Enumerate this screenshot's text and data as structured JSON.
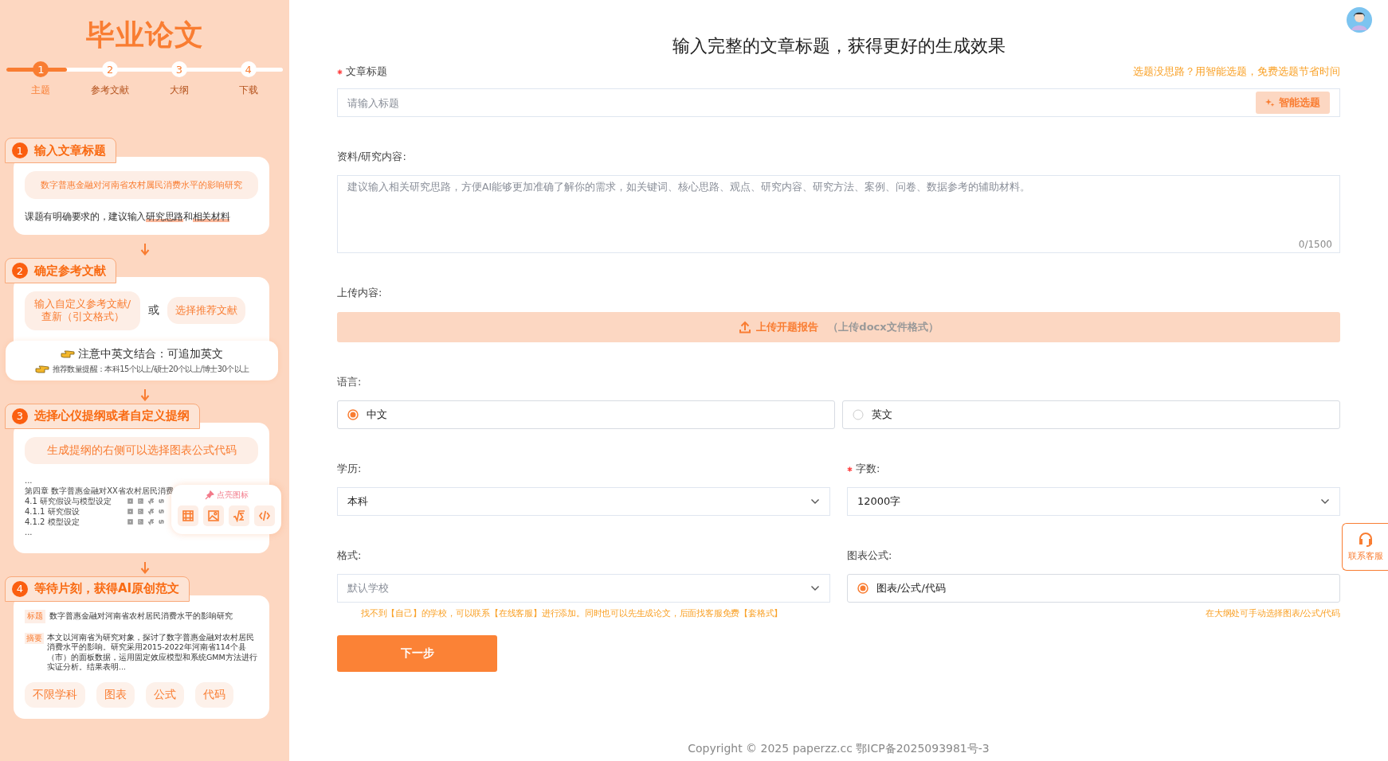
{
  "sidebar": {
    "title": "毕业论文",
    "steps": [
      {
        "number": "1",
        "label": "主题",
        "selected": true
      },
      {
        "number": "2",
        "label": "参考文献",
        "selected": false
      },
      {
        "number": "3",
        "label": "大纲",
        "selected": false
      },
      {
        "number": "4",
        "label": "下载",
        "selected": false
      }
    ],
    "guide_sections": [
      {
        "kind": "title",
        "number": "1",
        "heading": "输入文章标题",
        "example": "数字普惠金融对河南省农村属民消费水平的影响研究",
        "hint": "课题有明确要求的，建议输入**研究思路**和**相关材料**"
      },
      {
        "kind": "references",
        "number": "2",
        "heading": "确定参考文献",
        "options": [
          "输入自定义参考文献/查新（引文格式）",
          "选择推荐文献"
        ],
        "separator": "或",
        "notes": [
          "注意中英文结合：可追加英文",
          "推荐数量提醒：本科15个以上/硕士20个以上/博士30个以上"
        ]
      },
      {
        "kind": "outline",
        "number": "3",
        "heading": "选择心仪提纲或者自定义提纲",
        "banner": "生成提纲的右侧可以选择图表公式代码",
        "outline_lines": [
          {
            "text": "...",
            "kind": "plain"
          },
          {
            "text": "第四章 数字普惠金融对XX省农村居民消费",
            "kind": "plain"
          },
          {
            "text": "4.1 研究假设与模型设定",
            "kind": "icons"
          },
          {
            "text": "4.1.1 研究假设",
            "kind": "icons"
          },
          {
            "text": "4.1.2 模型设定",
            "kind": "icons"
          },
          {
            "text": "...",
            "kind": "plain"
          }
        ],
        "popover_label": "点亮图标"
      },
      {
        "kind": "sample",
        "number": "4",
        "heading": "等待片刻，获得AI原创范文",
        "title_tag": "标题",
        "title": "数字普惠金融对河南省农村居民消费水平的影响研究",
        "abstract_tag": "摘要",
        "abstract": "本文以河南省为研究对象，探讨了数字普惠金融对农村居民消费水平的影响。研究采用2015-2022年河南省114个县（市）的面板数据，运用固定效应模型和系统GMM方法进行实证分析。结果表明...",
        "tags": [
          "不限学科",
          "图表",
          "公式",
          "代码"
        ]
      }
    ]
  },
  "main": {
    "heading": "输入完整的文章标题，获得更好的生成效果",
    "title_field": {
      "label": "文章标题",
      "required": true,
      "tip": "选题没思路？用智能选题，免费选题节省时间",
      "placeholder": "请输入标题",
      "button": "智能选题"
    },
    "materials": {
      "label": "资料/研究内容:",
      "placeholder": "建议输入相关研究思路，方便AI能够更加准确了解你的需求，如关键词、核心思路、观点、研究内容、研究方法、案例、问卷、数据参考的辅助材料。",
      "counter": "0/1500"
    },
    "upload": {
      "label": "上传内容:",
      "button": "上传开题报告",
      "note": "（上传docx文件格式）"
    },
    "language": {
      "label": "语言:",
      "options": [
        {
          "label": "中文",
          "selected": true
        },
        {
          "label": "英文",
          "selected": false
        }
      ]
    },
    "degree": {
      "label": "学历:",
      "required": false,
      "value": "本科"
    },
    "word_count": {
      "label": "字数:",
      "required": true,
      "value": "12000字"
    },
    "format": {
      "label": "格式:",
      "placeholder": "默认学校",
      "note": "找不到【自己】的学校，可以联系【在线客服】进行添加。同时也可以先生成论文，后面找客服免费【套格式】"
    },
    "charts": {
      "label": "图表公式:",
      "option": {
        "label": "图表/公式/代码",
        "selected": true
      },
      "note": "在大纲处可手动选择图表/公式/代码"
    },
    "next_button": "下一步",
    "footer": "Copyright © 2025 paperzz.cc 鄂ICP备2025093981号-3"
  },
  "support": {
    "label": "联系客服"
  }
}
